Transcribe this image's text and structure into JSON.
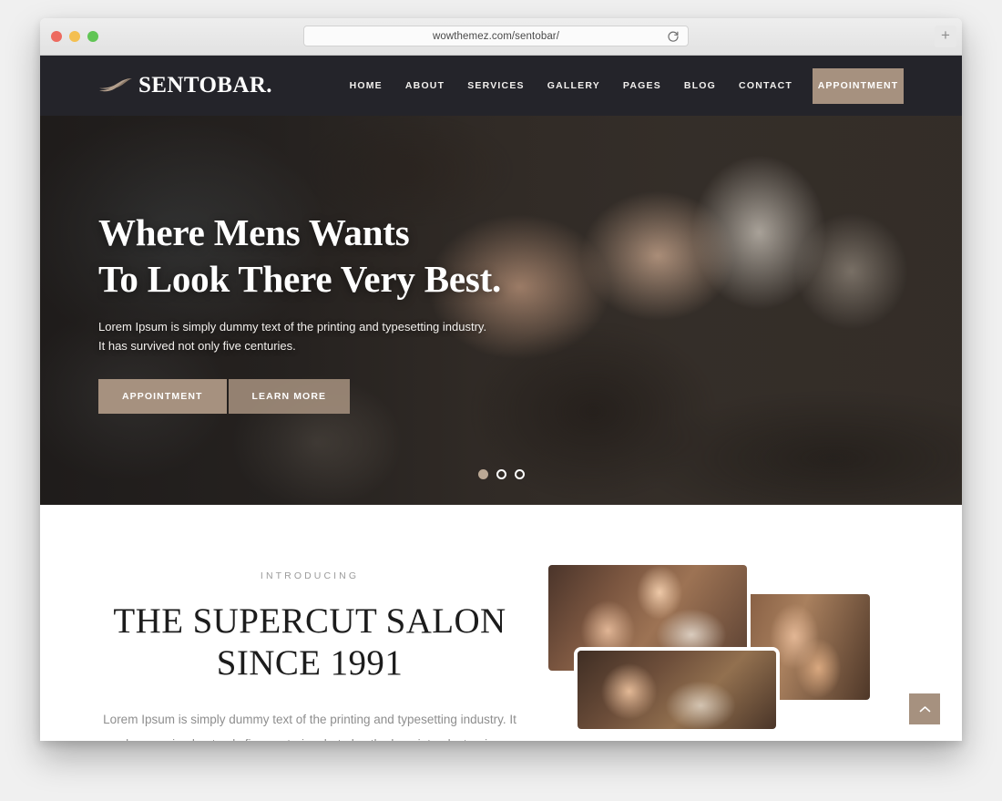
{
  "browser": {
    "url": "wowthemez.com/sentobar/",
    "reload_icon": "reload-icon",
    "new_tab_label": "+",
    "traffic_lights": [
      "close",
      "minimize",
      "maximize"
    ]
  },
  "site": {
    "logo_text": "SENTOBAR.",
    "logo_mark": "feather-icon",
    "nav": [
      {
        "label": "HOME"
      },
      {
        "label": "ABOUT"
      },
      {
        "label": "SERVICES"
      },
      {
        "label": "GALLERY"
      },
      {
        "label": "PAGES"
      },
      {
        "label": "BLOG"
      },
      {
        "label": "CONTACT"
      }
    ],
    "appointment_button": "APPOINTMENT"
  },
  "hero": {
    "title_line1": "Where Mens Wants",
    "title_line2": "To Look There Very Best.",
    "subtitle_line1": "Lorem Ipsum is simply dummy text of the printing and typesetting industry.",
    "subtitle_line2": "It has survived not only five centuries.",
    "primary_button": "APPOINTMENT",
    "secondary_button": "LEARN MORE",
    "slide_count": 3,
    "active_slide": 1
  },
  "intro": {
    "eyebrow": "INTRODUCING",
    "title_line1": "THE SUPERCUT SALON",
    "title_line2": "SINCE 1991",
    "paragraph": "Lorem Ipsum is simply dummy text of the printing and typesetting industry. It has survived not only five centuries, but also the leap into electronic typesetting, remaining essentially unchanged."
  },
  "scroll_top": {
    "icon": "chevron-up-icon"
  },
  "colors": {
    "accent": "#a6917f",
    "header_bg": "#24242a",
    "heading": "#1c1c1c",
    "muted_text": "#8e8e8e"
  }
}
